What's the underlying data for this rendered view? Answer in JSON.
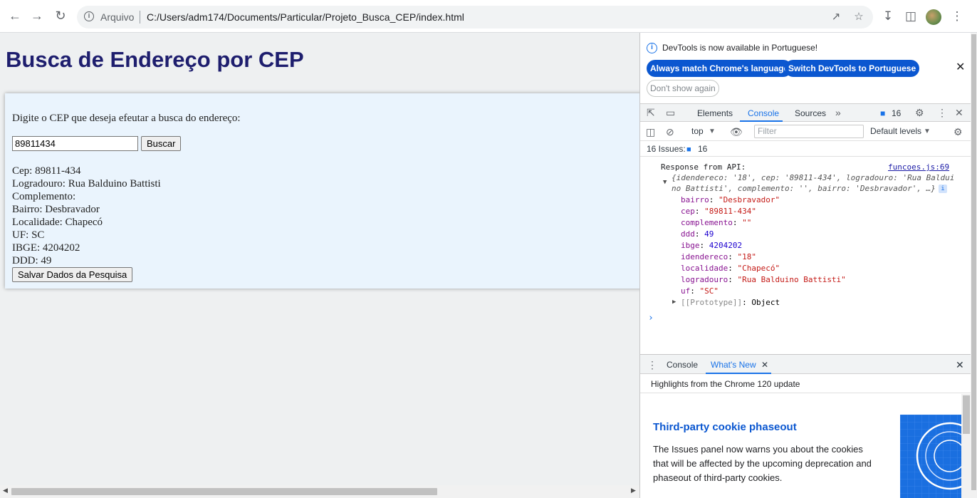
{
  "browser": {
    "back_icon": "arrow-left-icon",
    "forward_icon": "arrow-right-icon",
    "reload_icon": "reload-icon",
    "security_label": "Arquivo",
    "url": "C:/Users/adm174/Documents/Particular/Projeto_Busca_CEP/index.html"
  },
  "page": {
    "title": "Busca de Endereço por CEP",
    "prompt": "Digite o CEP que deseja efeutar a busca do endereço:",
    "cep_value": "89811434",
    "search_button": "Buscar",
    "results": [
      "Cep: 89811-434",
      "Logradouro: Rua Balduino Battisti",
      "Complemento:",
      "Bairro: Desbravador",
      "Localidade: Chapecó",
      "UF: SC",
      "IBGE: 4204202",
      "DDD: 49"
    ],
    "save_button": "Salvar Dados da Pesquisa"
  },
  "devtools": {
    "notice": "DevTools is now available in Portuguese!",
    "match_language": "Always match Chrome's language",
    "switch_language": "Switch DevTools to Portuguese",
    "dont_show": "Don't show again",
    "tabs": [
      "Elements",
      "Console",
      "Sources"
    ],
    "active_tab": "Console",
    "issues_count": "16",
    "context": "top",
    "filter_placeholder": "Filter",
    "levels": "Default levels",
    "issues_label": "16 Issues:",
    "issues_num": "16",
    "log_label": "Response from API:",
    "source_link": "funcoes.js:69",
    "summary_line1": "{idendereco: '18', cep: '89811-434', logradouro: 'Rua Baldui",
    "summary_line2": "no Battisti', complemento: '', bairro: 'Desbravador', …}",
    "props": [
      {
        "key": "bairro",
        "value": "\"Desbravador\"",
        "type": "s"
      },
      {
        "key": "cep",
        "value": "\"89811-434\"",
        "type": "s"
      },
      {
        "key": "complemento",
        "value": "\"\"",
        "type": "s"
      },
      {
        "key": "ddd",
        "value": "49",
        "type": "n"
      },
      {
        "key": "ibge",
        "value": "4204202",
        "type": "n"
      },
      {
        "key": "idendereco",
        "value": "\"18\"",
        "type": "s"
      },
      {
        "key": "localidade",
        "value": "\"Chapecó\"",
        "type": "s"
      },
      {
        "key": "logradouro",
        "value": "\"Rua Balduino Battisti\"",
        "type": "s"
      },
      {
        "key": "uf",
        "value": "\"SC\"",
        "type": "s"
      }
    ],
    "prototype_key": "[[Prototype]]",
    "prototype_value": "Object",
    "drawer_tabs": [
      "Console",
      "What's New"
    ],
    "whats_new_header": "Highlights from the Chrome 120 update",
    "whats_new_title": "Third-party cookie phaseout",
    "whats_new_desc": "The Issues panel now warns you about the cookies that will be affected by the upcoming deprecation and phaseout of third-party cookies."
  }
}
